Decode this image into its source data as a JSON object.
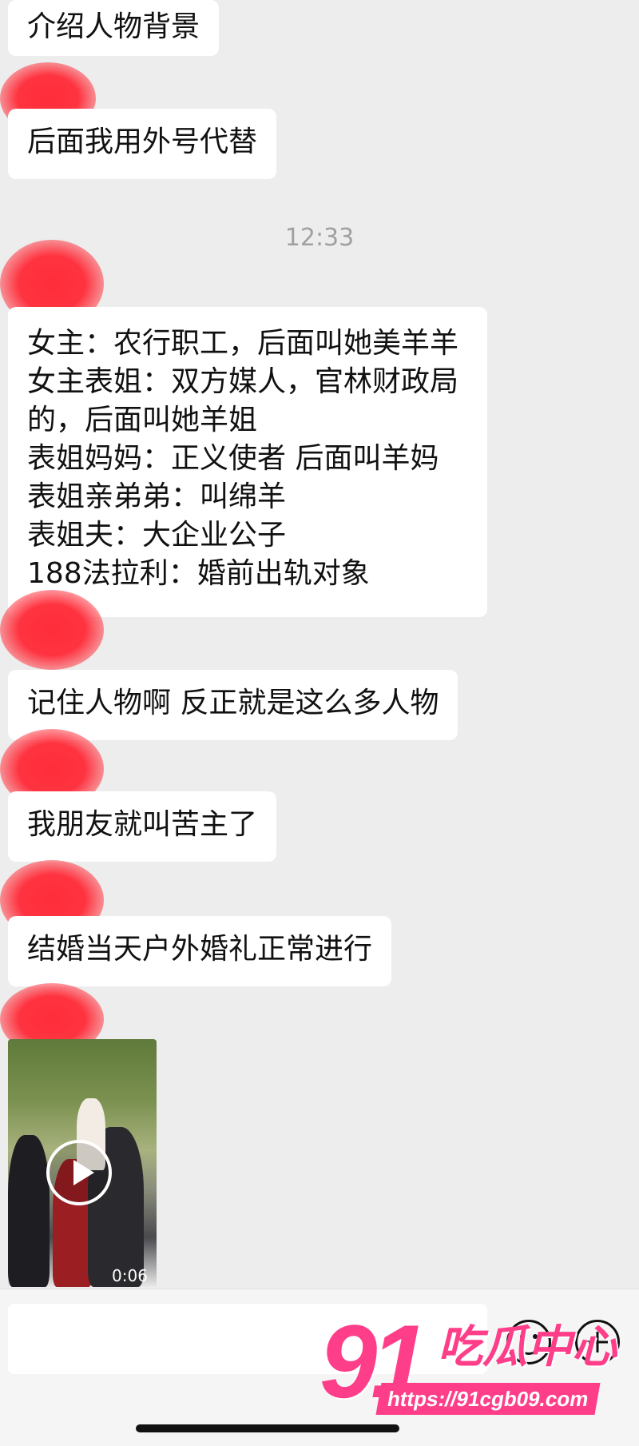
{
  "messages": [
    {
      "text": "介绍人物背景"
    },
    {
      "text": "后面我用外号代替"
    },
    {
      "text": "女主：农行职工，后面叫她美羊羊\n女主表姐：双方媒人，官林财政局\n的，后面叫她羊姐\n表姐妈妈：正义使者  后面叫羊妈\n表姐亲弟弟：叫绵羊\n表姐夫：大企业公子\n188法拉利：婚前出轨对象"
    },
    {
      "text": "记住人物啊 反正就是这么多人物"
    },
    {
      "text": "我朋友就叫苦主了"
    },
    {
      "text": "结婚当天户外婚礼正常进行"
    }
  ],
  "timestamp": "12:33",
  "video": {
    "duration": "0:06"
  },
  "watermark": {
    "number": "91",
    "title": "吃瓜中心",
    "url": "https://91cgb09.com"
  },
  "colors": {
    "background": "#ededed",
    "bubble": "#ffffff",
    "redaction": "#ff2d3a",
    "watermark": "#ff3e8a"
  },
  "icons": [
    "play-icon",
    "emoji-icon",
    "plus-icon"
  ]
}
